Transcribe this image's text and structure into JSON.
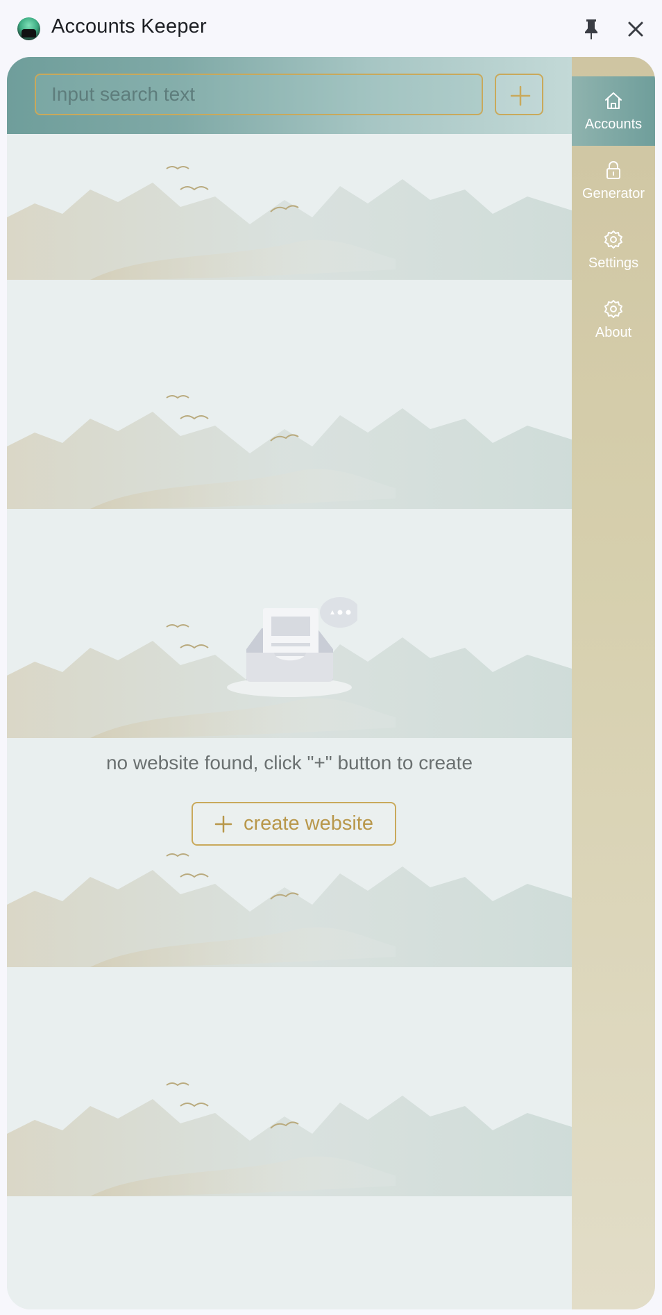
{
  "app": {
    "title": "Accounts Keeper"
  },
  "titlebar": {
    "pin_icon": "pin-icon",
    "close_icon": "close-icon"
  },
  "search": {
    "placeholder": "Input search text",
    "value": ""
  },
  "add_button": {
    "icon": "plus-icon"
  },
  "empty_state": {
    "message": "no website found, click \"+\" button to create",
    "button_label": "create website",
    "button_icon": "plus-icon"
  },
  "sidebar": {
    "items": [
      {
        "label": "Accounts",
        "icon": "home-icon",
        "active": true
      },
      {
        "label": "Generator",
        "icon": "lock-icon",
        "active": false
      },
      {
        "label": "Settings",
        "icon": "gear-icon",
        "active": false
      },
      {
        "label": "About",
        "icon": "gear-icon",
        "active": false
      }
    ]
  },
  "colors": {
    "accent_gold": "#c9a95b",
    "header_teal": "#6f9e9b",
    "sidebar_sand": "#d6cfad"
  }
}
